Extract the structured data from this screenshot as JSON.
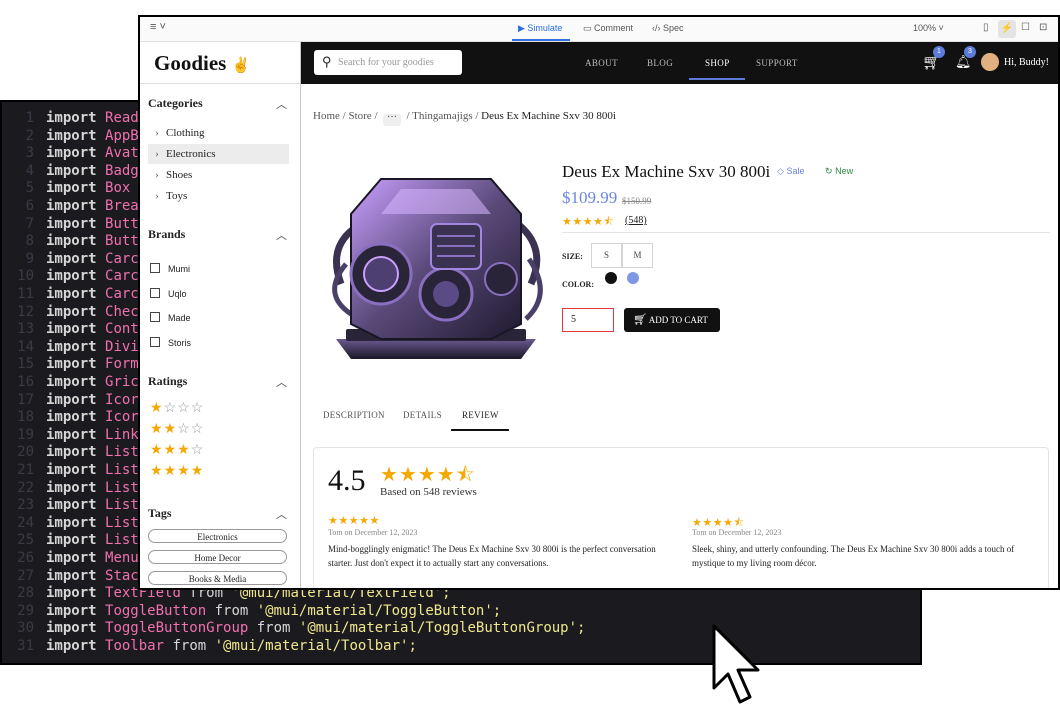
{
  "editor": {
    "lines": [
      {
        "no": "1",
        "name": "Read"
      },
      {
        "no": "2",
        "name": "AppB"
      },
      {
        "no": "3",
        "name": "Avat"
      },
      {
        "no": "4",
        "name": "Badg"
      },
      {
        "no": "5",
        "name": "Box"
      },
      {
        "no": "6",
        "name": "Brea"
      },
      {
        "no": "7",
        "name": "Butt"
      },
      {
        "no": "8",
        "name": "Butt"
      },
      {
        "no": "9",
        "name": "Carc"
      },
      {
        "no": "10",
        "name": "Carc"
      },
      {
        "no": "11",
        "name": "Carc"
      },
      {
        "no": "12",
        "name": "Chec"
      },
      {
        "no": "13",
        "name": "Cont"
      },
      {
        "no": "14",
        "name": "Divi"
      },
      {
        "no": "15",
        "name": "Form"
      },
      {
        "no": "16",
        "name": "Gric"
      },
      {
        "no": "17",
        "name": "Icor"
      },
      {
        "no": "18",
        "name": "Icor"
      },
      {
        "no": "19",
        "name": "Link"
      },
      {
        "no": "20",
        "name": "List"
      },
      {
        "no": "21",
        "name": "List"
      },
      {
        "no": "22",
        "name": "List"
      },
      {
        "no": "23",
        "name": "List"
      },
      {
        "no": "24",
        "name": "List"
      },
      {
        "no": "25",
        "name": "List"
      },
      {
        "no": "26",
        "name": "Menu"
      },
      {
        "no": "27",
        "name": "Stac"
      },
      {
        "no": "28",
        "name": "TextField",
        "from": "from",
        "path": "'@mui/material/TextField';"
      },
      {
        "no": "29",
        "name": "ToggleButton",
        "from": "from",
        "path": "'@mui/material/ToggleButton';"
      },
      {
        "no": "30",
        "name": "ToggleButtonGroup",
        "from": "from",
        "path": "'@mui/material/ToggleButtonGroup';"
      },
      {
        "no": "31",
        "name": "Toolbar",
        "from": "from",
        "path": "'@mui/material/Toolbar';"
      }
    ],
    "keyword": "import"
  },
  "toolbar": {
    "simulate": "Simulate",
    "comment": "Comment",
    "spec": "Spec",
    "zoom": "100%",
    "accent": "#2f6fe0"
  },
  "sidebar": {
    "logo": "Goodies",
    "categories_title": "Categories",
    "categories": [
      "Clothing",
      "Electronics",
      "Shoes",
      "Toys"
    ],
    "selected_category": "Electronics",
    "brands_title": "Brands",
    "brands": [
      "Mumi",
      "Uqlo",
      "Made",
      "Storis"
    ],
    "ratings_title": "Ratings",
    "ratings": [
      1,
      2,
      3,
      4
    ],
    "tags_title": "Tags",
    "tags": [
      "Electronics",
      "Home Decor",
      "Books & Media"
    ]
  },
  "nav": {
    "search_placeholder": "Search for your goodies",
    "links": [
      "ABOUT",
      "BLOG",
      "SHOP",
      "SUPPORT"
    ],
    "active": "SHOP",
    "cart_badge": "1",
    "bell_badge": "3",
    "greeting": "Hi, Buddy!"
  },
  "breadcrumb": [
    "Home",
    "Store",
    "Thingamajigs",
    "Deus Ex Machine Sxv 30 800i"
  ],
  "product": {
    "title": "Deus Ex Machine Sxv 30 800i",
    "sale_label": "Sale",
    "new_label": "New",
    "price": "$109.99",
    "old_price": "$150.99",
    "rating": 4.5,
    "review_count": "(548)",
    "size_label": "SIZE:",
    "sizes": [
      "S",
      "M"
    ],
    "color_label": "COLOR:",
    "colors": [
      "#111111",
      "#7f98e6"
    ],
    "quantity": "5",
    "add_to_cart": "ADD TO CART",
    "accent": "#6b86dd"
  },
  "tabs": [
    "DESCRIPTION",
    "DETAILS",
    "REVIEW"
  ],
  "active_tab": "REVIEW",
  "reviews": {
    "average": "4.5",
    "based_on": "Based on 548 reviews",
    "items": [
      {
        "stars": 5,
        "meta": "Tom on December 12, 2023",
        "text": "Mind-bogglingly enigmatic! The Deus Ex Machine Sxv 30 800i is the perfect conversation starter. Just don't expect it to actually start any conversations."
      },
      {
        "stars": 4.5,
        "meta": "Tom on December 12, 2023",
        "text": "Sleek, shiny, and utterly confounding. The Deus Ex Machine Sxv 30 800i adds a touch of mystique to my living room décor."
      }
    ]
  }
}
